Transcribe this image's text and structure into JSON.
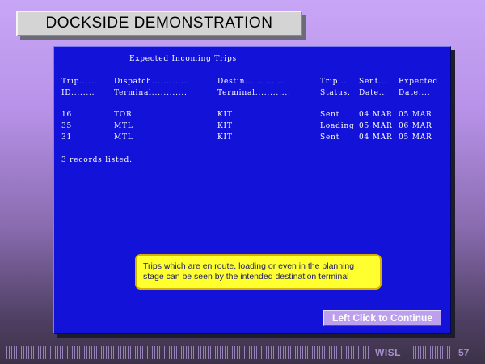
{
  "window": {
    "title": "DOCKSIDE DEMONSTRATION"
  },
  "screen": {
    "heading": "Expected Incoming Trips",
    "header_row1": {
      "trip": "Trip......",
      "dispatch": "Dispatch............",
      "destin": "Destin..............",
      "trip_status": "Trip...",
      "sent": "Sent...",
      "expected": "Expected"
    },
    "header_row2": {
      "trip": "ID........",
      "dispatch": "Terminal............",
      "destin": "Terminal............",
      "trip_status": "Status.",
      "sent": "Date...",
      "expected": "Date...."
    },
    "rows": [
      {
        "trip_id": "16",
        "dispatch": "TOR",
        "destin": "KIT",
        "status": "Sent",
        "sent_date": "04 MAR",
        "expected_date": "05 MAR"
      },
      {
        "trip_id": "35",
        "dispatch": "MTL",
        "destin": "KIT",
        "status": "Loading",
        "sent_date": "05 MAR",
        "expected_date": "06 MAR"
      },
      {
        "trip_id": "31",
        "dispatch": "MTL",
        "destin": "KIT",
        "status": "Sent",
        "sent_date": "04 MAR",
        "expected_date": "05 MAR"
      }
    ],
    "records_listed": "3 records listed."
  },
  "callout": {
    "line1": "Trips which are en route, loading or even in the planning",
    "line2": "stage can be seen by the intended destination terminal"
  },
  "continue_button": {
    "label": "Left Click to Continue"
  },
  "footer": {
    "brand": "WISL",
    "page_number": "57"
  },
  "colors": {
    "screen_bg": "#1212d8",
    "callout_bg": "#ffff30",
    "button_bg": "#bca0ee"
  }
}
